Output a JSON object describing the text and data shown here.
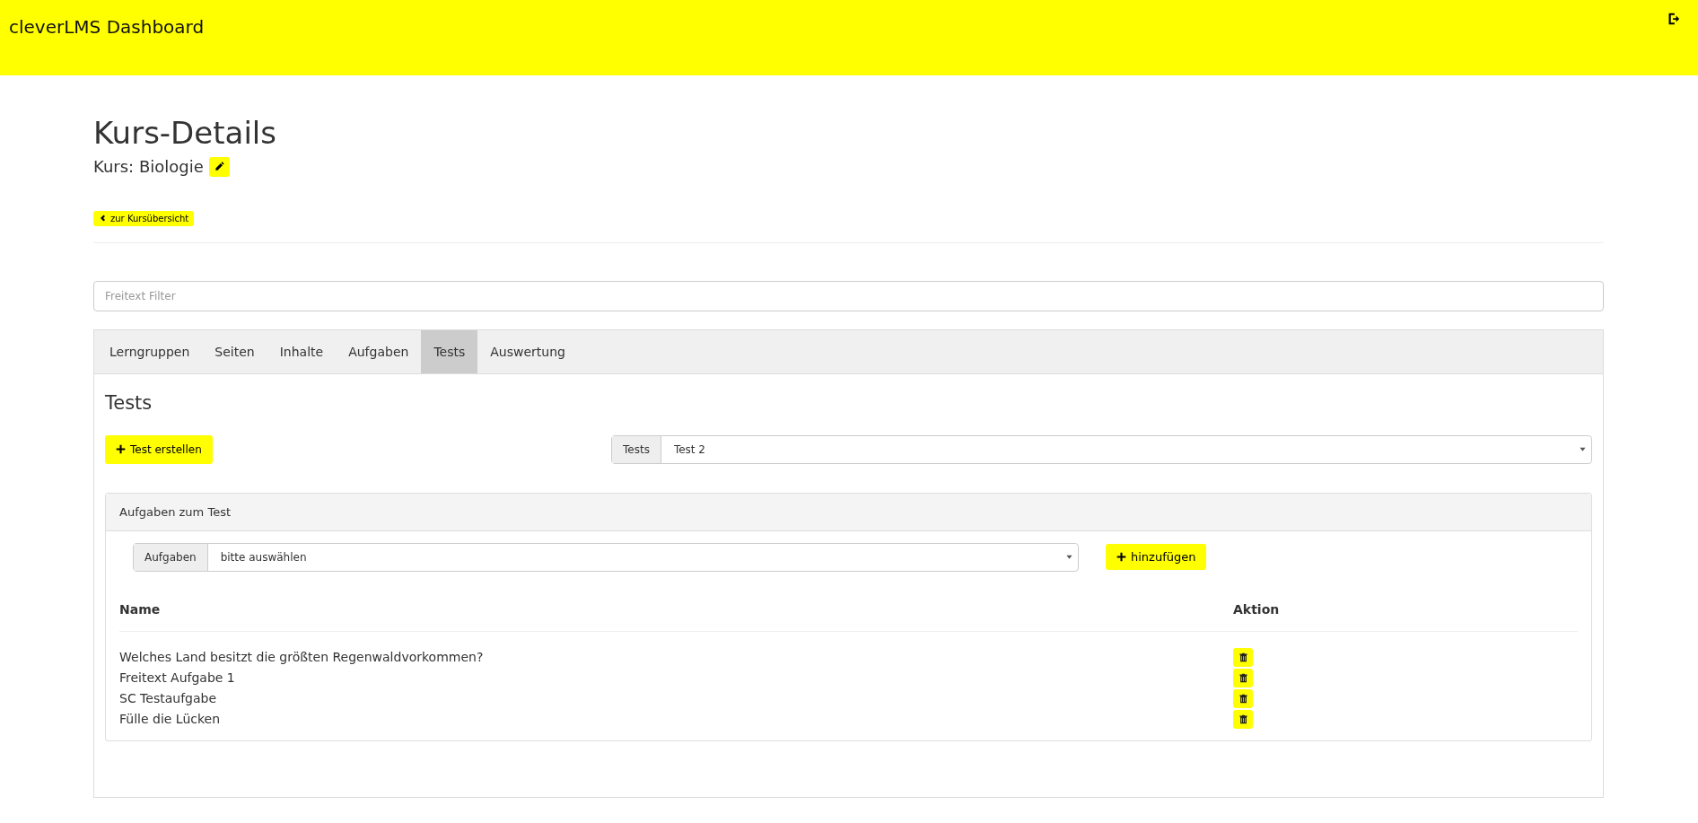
{
  "navbar": {
    "brand": "cleverLMS Dashboard"
  },
  "page": {
    "title": "Kurs-Details",
    "subtitle": "Kurs: Biologie",
    "back_button": "zur Kursübersicht"
  },
  "filter": {
    "placeholder": "Freitext Filter"
  },
  "tabs": [
    {
      "label": "Lerngruppen",
      "selected": false
    },
    {
      "label": "Seiten",
      "selected": false
    },
    {
      "label": "Inhalte",
      "selected": false
    },
    {
      "label": "Aufgaben",
      "selected": false
    },
    {
      "label": "Tests",
      "selected": true
    },
    {
      "label": "Auswertung",
      "selected": false
    }
  ],
  "section": {
    "title": "Tests",
    "create_button": "Test erstellen",
    "test_select": {
      "addon": "Tests",
      "value": "Test 2"
    }
  },
  "tasks_panel": {
    "title": "Aufgaben zum Test",
    "task_select": {
      "addon": "Aufgaben",
      "value": "bitte auswählen"
    },
    "add_button": "hinzufügen",
    "columns": [
      "Name",
      "Aktion"
    ],
    "rows": [
      {
        "name": "Welches Land besitzt die größten Regenwaldvorkommen?"
      },
      {
        "name": "Freitext Aufgabe 1"
      },
      {
        "name": "SC Testaufgabe"
      },
      {
        "name": "Fülle die Lücken"
      }
    ]
  }
}
